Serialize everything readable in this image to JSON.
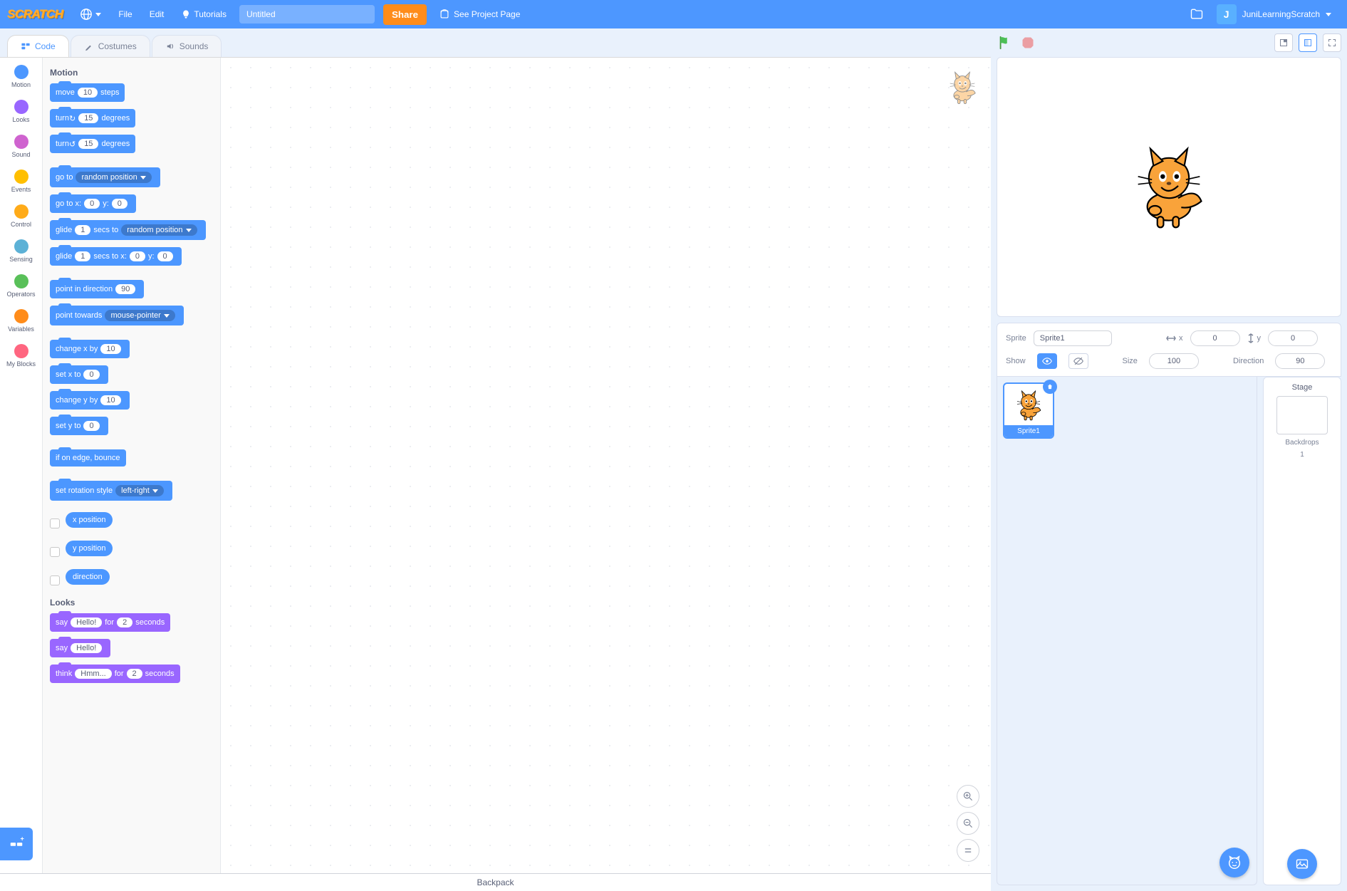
{
  "menubar": {
    "file": "File",
    "edit": "Edit",
    "tutorials": "Tutorials",
    "project_title": "Untitled",
    "share": "Share",
    "see_project": "See Project Page",
    "username": "JuniLearningScratch",
    "user_initial": "J"
  },
  "tabs": {
    "code": "Code",
    "costumes": "Costumes",
    "sounds": "Sounds"
  },
  "categories": [
    {
      "name": "Motion",
      "color": "#4c97ff"
    },
    {
      "name": "Looks",
      "color": "#9966ff"
    },
    {
      "name": "Sound",
      "color": "#cf63cf"
    },
    {
      "name": "Events",
      "color": "#ffbf00"
    },
    {
      "name": "Control",
      "color": "#ffab19"
    },
    {
      "name": "Sensing",
      "color": "#5cb1d6"
    },
    {
      "name": "Operators",
      "color": "#59c059"
    },
    {
      "name": "Variables",
      "color": "#ff8c1a"
    },
    {
      "name": "My Blocks",
      "color": "#ff6680"
    }
  ],
  "palette": {
    "motion_header": "Motion",
    "looks_header": "Looks",
    "move": {
      "pre": "move",
      "v": "10",
      "post": "steps"
    },
    "turn_cw": {
      "pre": "turn",
      "v": "15",
      "post": "degrees"
    },
    "turn_ccw": {
      "pre": "turn",
      "v": "15",
      "post": "degrees"
    },
    "goto": {
      "pre": "go to",
      "dd": "random position"
    },
    "goto_xy": {
      "pre": "go to x:",
      "x": "0",
      "mid": "y:",
      "y": "0"
    },
    "glide_to": {
      "pre": "glide",
      "s": "1",
      "mid": "secs to",
      "dd": "random position"
    },
    "glide_xy": {
      "pre": "glide",
      "s": "1",
      "mid": "secs to x:",
      "x": "0",
      "mid2": "y:",
      "y": "0"
    },
    "point_dir": {
      "pre": "point in direction",
      "v": "90"
    },
    "point_towards": {
      "pre": "point towards",
      "dd": "mouse-pointer"
    },
    "change_x": {
      "pre": "change x by",
      "v": "10"
    },
    "set_x": {
      "pre": "set x to",
      "v": "0"
    },
    "change_y": {
      "pre": "change y by",
      "v": "10"
    },
    "set_y": {
      "pre": "set y to",
      "v": "0"
    },
    "bounce": "if on edge, bounce",
    "rot_style": {
      "pre": "set rotation style",
      "dd": "left-right"
    },
    "xpos": "x position",
    "ypos": "y position",
    "direction": "direction",
    "say_secs": {
      "pre": "say",
      "msg": "Hello!",
      "mid": "for",
      "s": "2",
      "post": "seconds"
    },
    "say": {
      "pre": "say",
      "msg": "Hello!"
    },
    "think_secs": {
      "pre": "think",
      "msg": "Hmm...",
      "mid": "for",
      "s": "2",
      "post": "seconds"
    }
  },
  "sprite_info": {
    "sprite_label": "Sprite",
    "sprite_name": "Sprite1",
    "x_label": "x",
    "x": "0",
    "y_label": "y",
    "y": "0",
    "show_label": "Show",
    "size_label": "Size",
    "size": "100",
    "dir_label": "Direction",
    "dir": "90"
  },
  "stage_panel": {
    "stage": "Stage",
    "backdrops": "Backdrops",
    "backdrop_count": "1"
  },
  "backpack": "Backpack"
}
